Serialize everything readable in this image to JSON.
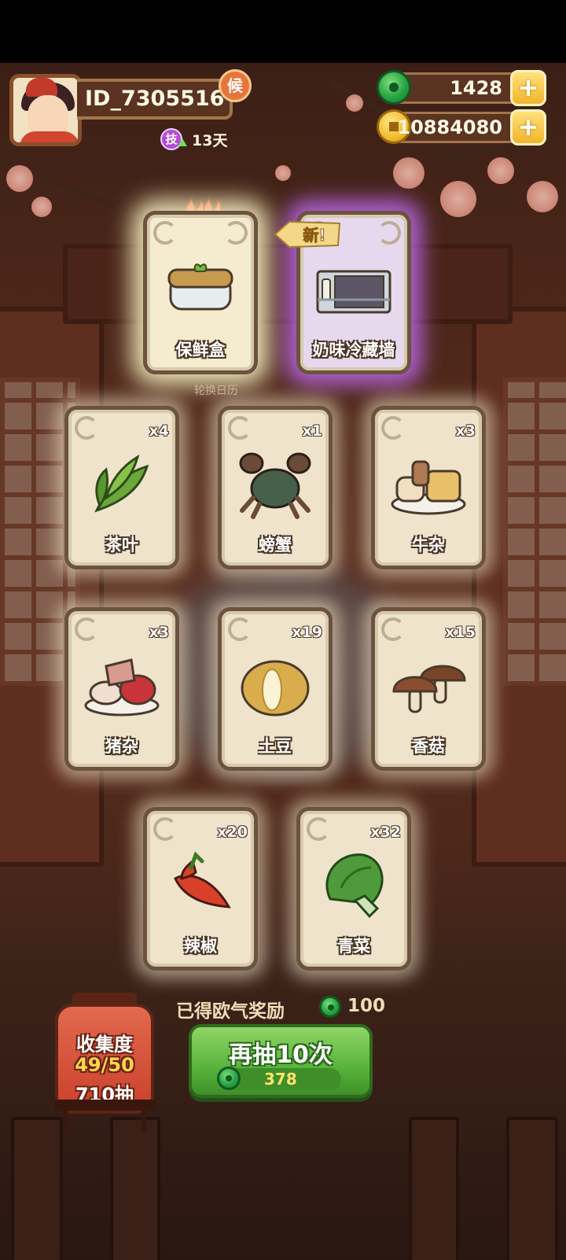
{
  "player": {
    "id": "ID_7305516",
    "badge": "候",
    "skill_icon": "技",
    "days": "13天"
  },
  "resources": {
    "jade": "1428",
    "coins": "10884080"
  },
  "scene": {
    "calendar_label": "轮换日历"
  },
  "featured_cards": [
    {
      "name": "保鲜盒",
      "icon": "food-container-icon",
      "tag": "fire"
    },
    {
      "name": "奶味冷藏墙",
      "icon": "fridge-wall-icon",
      "tag": "新!"
    }
  ],
  "cards": [
    {
      "name": "茶叶",
      "count": "x4",
      "icon": "tea-leaf-icon"
    },
    {
      "name": "螃蟹",
      "count": "x1",
      "icon": "crab-icon"
    },
    {
      "name": "牛杂",
      "count": "x3",
      "icon": "beef-offal-icon"
    },
    {
      "name": "猪杂",
      "count": "x3",
      "icon": "pork-offal-icon"
    },
    {
      "name": "土豆",
      "count": "x19",
      "icon": "potato-icon"
    },
    {
      "name": "香菇",
      "count": "x15",
      "icon": "mushroom-icon"
    },
    {
      "name": "辣椒",
      "count": "x20",
      "icon": "chili-icon"
    },
    {
      "name": "青菜",
      "count": "x32",
      "icon": "bok-choy-icon"
    }
  ],
  "reward": {
    "label": "已得欧气奖励",
    "value": "100"
  },
  "draw_button": {
    "label": "再抽10次",
    "cost": "378"
  },
  "collection": {
    "label": "收集度",
    "progress": "49/50",
    "draws": "710抽"
  },
  "colors": {
    "rare_glow": "#c86eff",
    "jade": "#2aa443",
    "button_green": "#58b33b"
  }
}
